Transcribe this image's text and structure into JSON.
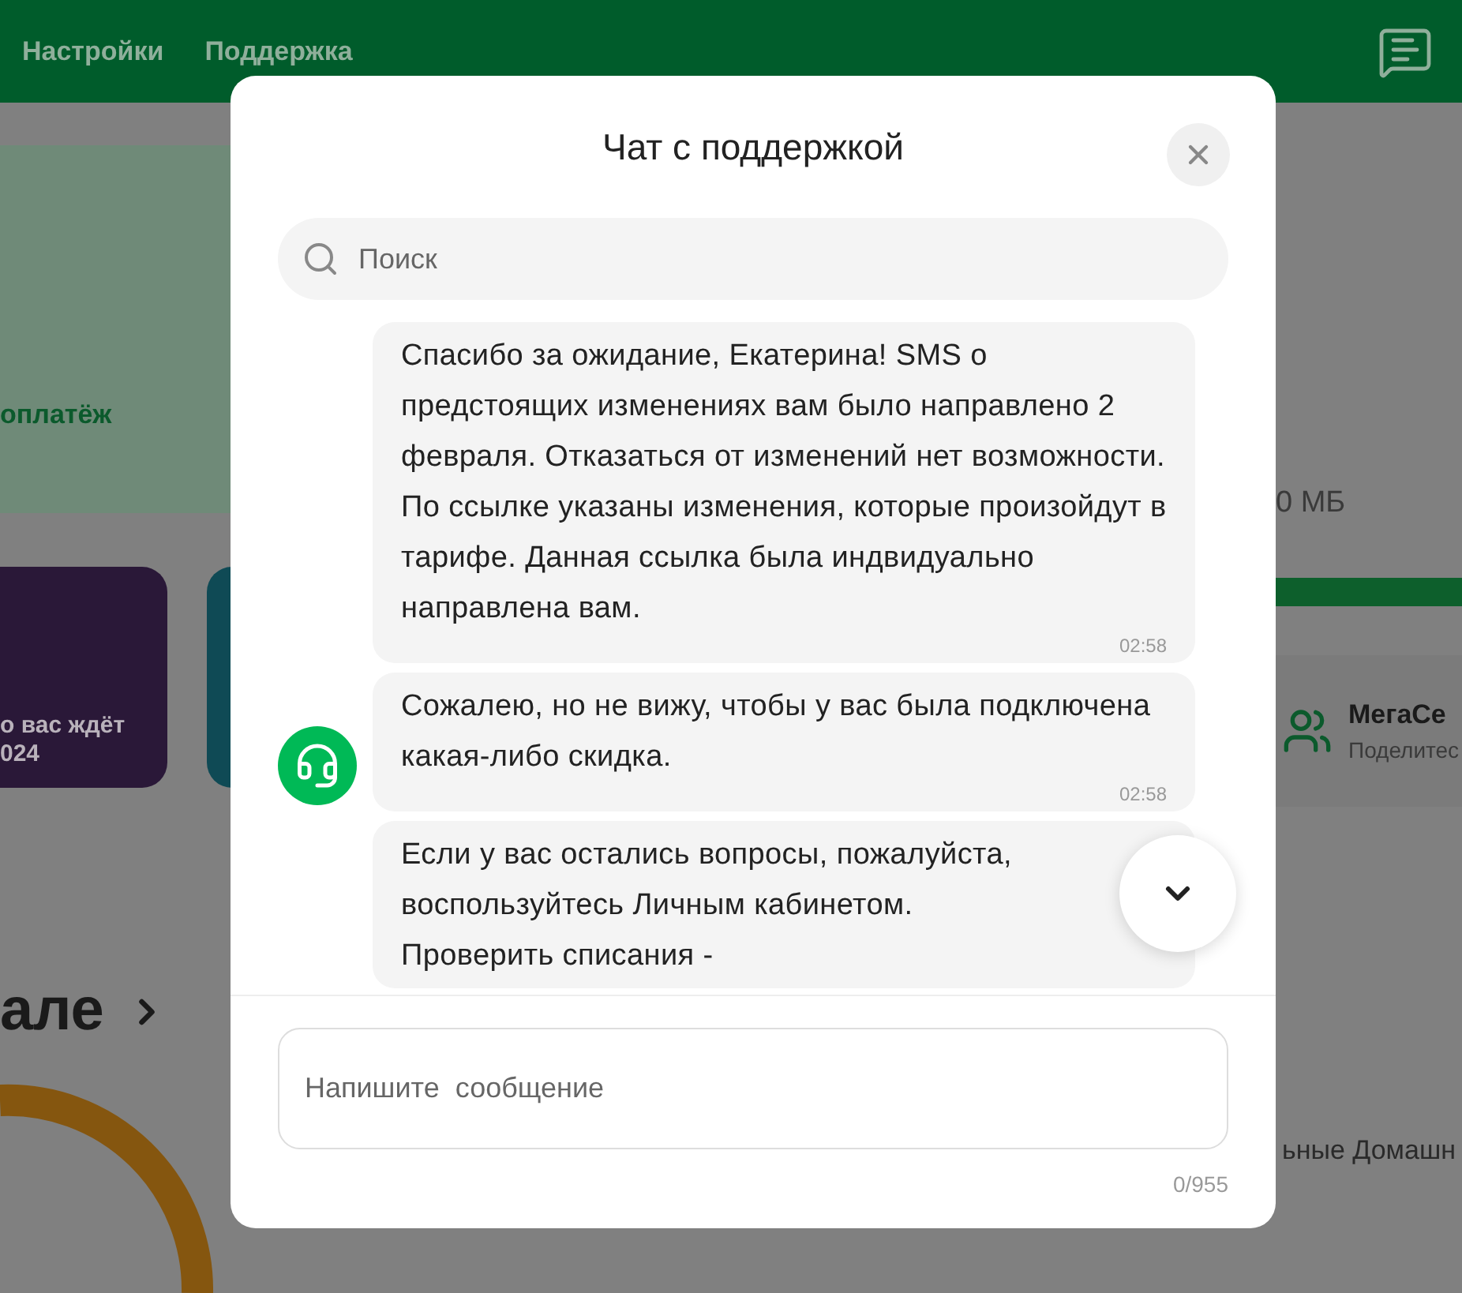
{
  "header": {
    "nav": [
      "Настройки",
      "Поддержка"
    ]
  },
  "background": {
    "promo_text": "оплатёж",
    "traffic": "0 МБ",
    "traffic_bar": {
      "level": 1
    },
    "story_title": "о вас ждёт",
    "story_year": "024",
    "service_name": "МегаСе",
    "service_sub": "Поделитес",
    "section_title": "але",
    "history_text": "ьные Домашн"
  },
  "chat": {
    "title": "Чат с поддержкой",
    "search": {
      "placeholder": "Поиск"
    },
    "messages": [
      {
        "text": "Спасибо за ожидание, Екатерина! SMS о предстоящих изменениях вам было направлено 2 февраля. Отказаться от изменений нет возможности. По ссылке указаны изменения, которые произойдут в тарифе. Данная ссылка была индвидуально направлена вам.",
        "time": "02:58"
      },
      {
        "text": "Сожалею, но не вижу, чтобы у вас была подключена какая-либо скидка.",
        "time": "02:58"
      },
      {
        "text": "Если у вас остались вопросы, пожалуйста, воспользуйтесь Личным кабинетом.\nПроверить списания -"
      }
    ],
    "input": {
      "placeholder": "Напишите  сообщение"
    },
    "counter": "0/955"
  }
}
